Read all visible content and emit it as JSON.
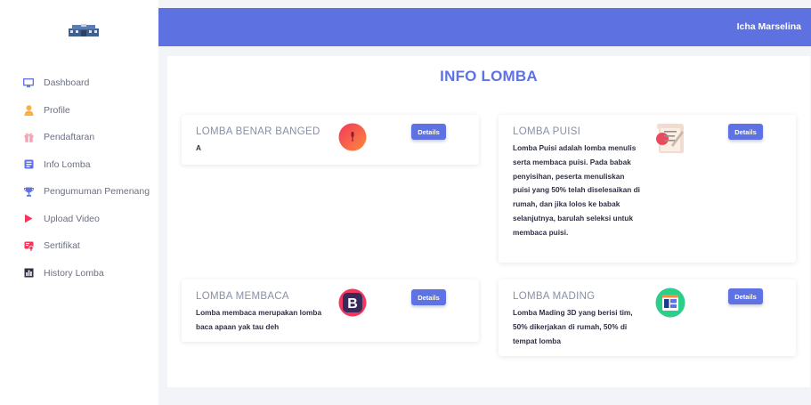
{
  "colors": {
    "accent": "#5e72e4",
    "topbar": "#5d71e0",
    "background": "#f3f4f7"
  },
  "header": {
    "username": "Icha Marselina"
  },
  "sidebar": {
    "logo": "school-building-logo",
    "items": [
      {
        "label": "Dashboard",
        "icon": "monitor-icon"
      },
      {
        "label": "Profile",
        "icon": "user-icon"
      },
      {
        "label": "Pendaftaran",
        "icon": "gift-icon"
      },
      {
        "label": "Info Lomba",
        "icon": "info-icon"
      },
      {
        "label": "Pengumuman Pemenang",
        "icon": "trophy-icon"
      },
      {
        "label": "Upload Video",
        "icon": "play-icon"
      },
      {
        "label": "Sertifikat",
        "icon": "certificate-icon"
      },
      {
        "label": "History Lomba",
        "icon": "history-icon"
      }
    ]
  },
  "main": {
    "title": "INFO LOMBA",
    "cards": [
      {
        "title": "LOMBA BENAR BANGED",
        "text": "A",
        "icon": "microphone-icon",
        "button": "Details"
      },
      {
        "title": "LOMBA PUISI",
        "text": "Lomba Puisi adalah lomba menulis serta membaca puisi. Pada babak penyisihan, peserta menuliskan puisi yang 50% telah diselesaikan di rumah, dan jika lolos ke babak selanjutnya, barulah seleksi untuk membaca puisi.",
        "icon": "poetry-paper-icon",
        "button": "Details"
      },
      {
        "title": "LOMBA MEMBACA",
        "text": "Lomba membaca merupakan lomba baca apaan yak tau deh",
        "icon": "letter-b-icon",
        "button": "Details"
      },
      {
        "title": "LOMBA MADING",
        "text": "Lomba Mading 3D yang berisi tim, 50% dikerjakan di rumah, 50% di tempat lomba",
        "icon": "wall-magazine-icon",
        "button": "Details"
      }
    ]
  }
}
